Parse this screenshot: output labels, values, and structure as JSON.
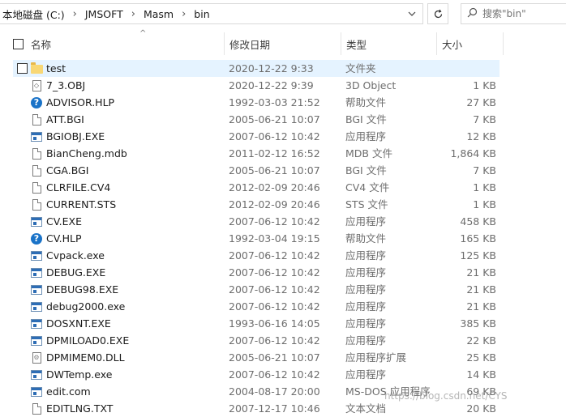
{
  "address": {
    "crumbs": [
      "本地磁盘 (C:)",
      "JMSOFT",
      "Masm",
      "bin"
    ],
    "separator": "›",
    "dropdown_icon": "chevron-down-icon"
  },
  "refresh_icon": "refresh-icon",
  "search": {
    "placeholder": "搜索\"bin\"",
    "icon": "search-icon"
  },
  "columns": {
    "name": "名称",
    "date": "修改日期",
    "type": "类型",
    "size": "大小"
  },
  "sort_indicator": "^",
  "files": [
    {
      "name": "test",
      "date": "2020-12-22 9:33",
      "type": "文件夹",
      "size": "",
      "icon": "folder"
    },
    {
      "name": "7_3.OBJ",
      "date": "2020-12-22 9:39",
      "type": "3D Object",
      "size": "1 KB",
      "icon": "obj"
    },
    {
      "name": "ADVISOR.HLP",
      "date": "1992-03-03 21:52",
      "type": "帮助文件",
      "size": "27 KB",
      "icon": "help"
    },
    {
      "name": "ATT.BGI",
      "date": "2005-06-21 10:07",
      "type": "BGI 文件",
      "size": "7 KB",
      "icon": "doc"
    },
    {
      "name": "BGIOBJ.EXE",
      "date": "2007-06-12 10:42",
      "type": "应用程序",
      "size": "12 KB",
      "icon": "exe"
    },
    {
      "name": "BianCheng.mdb",
      "date": "2011-02-12 16:52",
      "type": "MDB 文件",
      "size": "1,864 KB",
      "icon": "doc"
    },
    {
      "name": "CGA.BGI",
      "date": "2005-06-21 10:07",
      "type": "BGI 文件",
      "size": "7 KB",
      "icon": "doc"
    },
    {
      "name": "CLRFILE.CV4",
      "date": "2012-02-09 20:46",
      "type": "CV4 文件",
      "size": "1 KB",
      "icon": "doc"
    },
    {
      "name": "CURRENT.STS",
      "date": "2012-02-09 20:46",
      "type": "STS 文件",
      "size": "1 KB",
      "icon": "doc"
    },
    {
      "name": "CV.EXE",
      "date": "2007-06-12 10:42",
      "type": "应用程序",
      "size": "458 KB",
      "icon": "exe"
    },
    {
      "name": "CV.HLP",
      "date": "1992-03-04 19:15",
      "type": "帮助文件",
      "size": "165 KB",
      "icon": "help"
    },
    {
      "name": "Cvpack.exe",
      "date": "2007-06-12 10:42",
      "type": "应用程序",
      "size": "125 KB",
      "icon": "exe"
    },
    {
      "name": "DEBUG.EXE",
      "date": "2007-06-12 10:42",
      "type": "应用程序",
      "size": "21 KB",
      "icon": "exe"
    },
    {
      "name": "DEBUG98.EXE",
      "date": "2007-06-12 10:42",
      "type": "应用程序",
      "size": "21 KB",
      "icon": "exe"
    },
    {
      "name": "debug2000.exe",
      "date": "2007-06-12 10:42",
      "type": "应用程序",
      "size": "21 KB",
      "icon": "exe"
    },
    {
      "name": "DOSXNT.EXE",
      "date": "1993-06-16 14:05",
      "type": "应用程序",
      "size": "385 KB",
      "icon": "exe"
    },
    {
      "name": "DPMILOAD0.EXE",
      "date": "2007-06-12 10:42",
      "type": "应用程序",
      "size": "22 KB",
      "icon": "exe"
    },
    {
      "name": "DPMIMEM0.DLL",
      "date": "2005-06-21 10:07",
      "type": "应用程序扩展",
      "size": "25 KB",
      "icon": "dll"
    },
    {
      "name": "DWTemp.exe",
      "date": "2007-06-12 10:42",
      "type": "应用程序",
      "size": "14 KB",
      "icon": "exe"
    },
    {
      "name": "edit.com",
      "date": "2004-08-17 20:00",
      "type": "MS-DOS 应用程序",
      "size": "69 KB",
      "icon": "exe"
    },
    {
      "name": "EDITLNG.TXT",
      "date": "2007-12-17 10:46",
      "type": "文本文档",
      "size": "20 KB",
      "icon": "doc"
    }
  ],
  "selected_index": 0,
  "watermark": "https://blog.csdn.net/CYS"
}
